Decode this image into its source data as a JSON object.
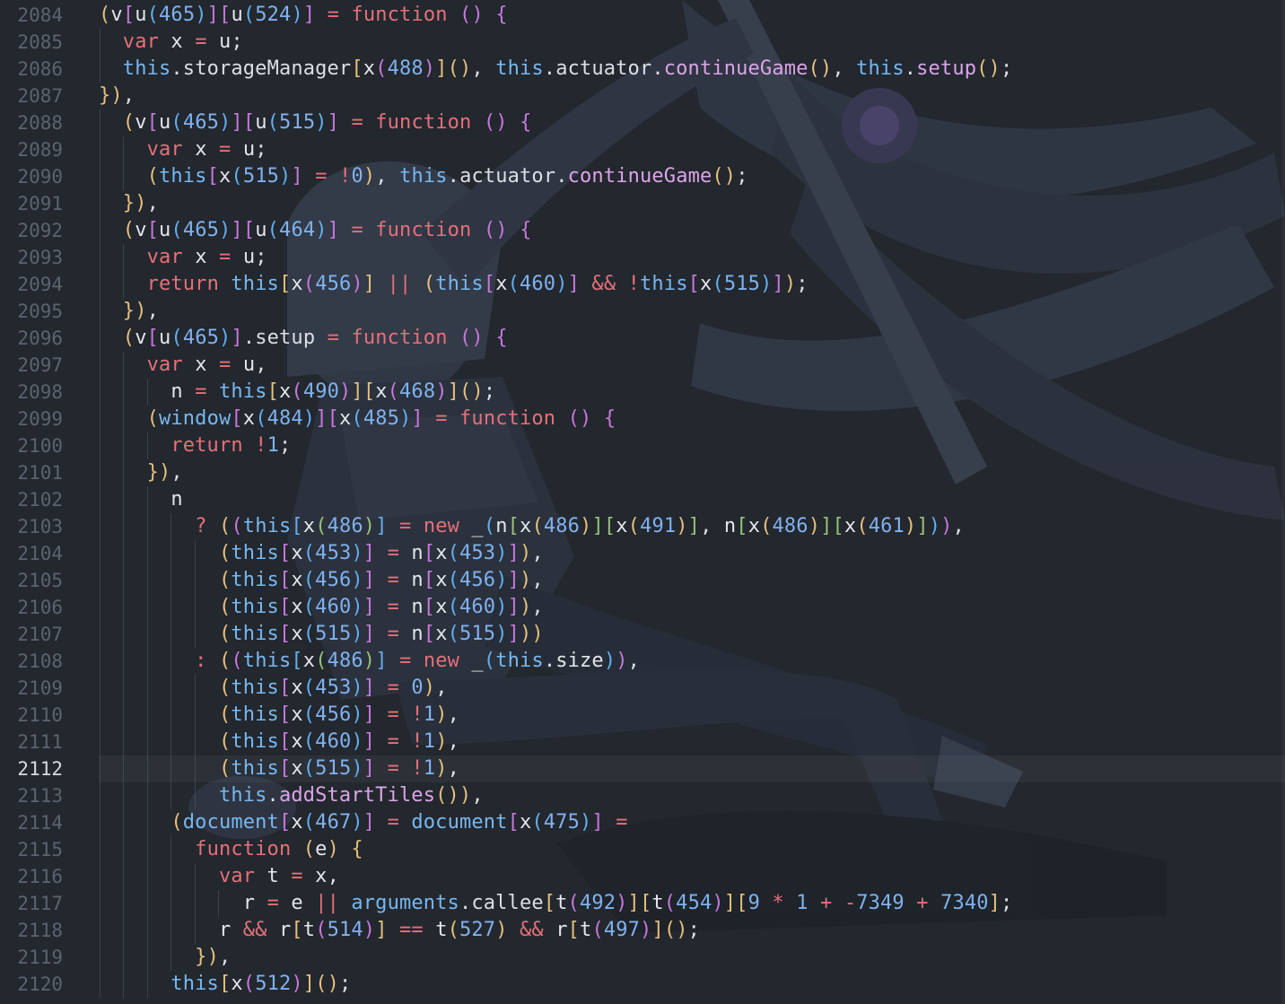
{
  "editor": {
    "active_line": "2112",
    "line_numbers": [
      "2084",
      "2085",
      "2086",
      "2087",
      "2088",
      "2089",
      "2090",
      "2091",
      "2092",
      "2093",
      "2094",
      "2095",
      "2096",
      "2097",
      "2098",
      "2099",
      "2100",
      "2101",
      "2102",
      "2103",
      "2104",
      "2105",
      "2106",
      "2107",
      "2108",
      "2109",
      "2110",
      "2111",
      "2112",
      "2113",
      "2114",
      "2115",
      "2116",
      "2117",
      "2118",
      "2119",
      "2120"
    ],
    "code_lines": [
      "(v[u(465)][u(524)] = function () {",
      "  var x = u;",
      "  this.storageManager[x(488)](), this.actuator.continueGame(), this.setup();",
      "}),",
      "  (v[u(465)][u(515)] = function () {",
      "    var x = u;",
      "    (this[x(515)] = !0), this.actuator.continueGame();",
      "  }),",
      "  (v[u(465)][u(464)] = function () {",
      "    var x = u;",
      "    return this[x(456)] || (this[x(460)] && !this[x(515)]);",
      "  }),",
      "  (v[u(465)].setup = function () {",
      "    var x = u,",
      "      n = this[x(490)][x(468)]();",
      "    (window[x(484)][x(485)] = function () {",
      "      return !1;",
      "    }),",
      "      n",
      "        ? ((this[x(486)] = new _(n[x(486)][x(491)], n[x(486)][x(461)])),",
      "          (this[x(453)] = n[x(453)]),",
      "          (this[x(456)] = n[x(456)]),",
      "          (this[x(460)] = n[x(460)]),",
      "          (this[x(515)] = n[x(515)]))",
      "        : ((this[x(486)] = new _(this.size)),",
      "          (this[x(453)] = 0),",
      "          (this[x(456)] = !1),",
      "          (this[x(460)] = !1),",
      "          (this[x(515)] = !1),",
      "          this.addStartTiles()),",
      "      (document[x(467)] = document[x(475)] =",
      "        function (e) {",
      "          var t = x,",
      "            r = e || arguments.callee[t(492)][t(454)][9 * 1 + -7349 + 7340];",
      "          r && r[t(514)] == t(527) && r[t(497)]();",
      "        }),",
      "      this[x(512)]();"
    ],
    "colors": {
      "background": "#23272e",
      "keyword": "#e5707a",
      "function_call": "#dba4e8",
      "this": "#77b8f0",
      "number": "#7fb2ef",
      "line_number": "#5c6370",
      "line_number_active": "#d7dae0"
    },
    "wallpaper_icon": "anime-character-wallpaper"
  }
}
